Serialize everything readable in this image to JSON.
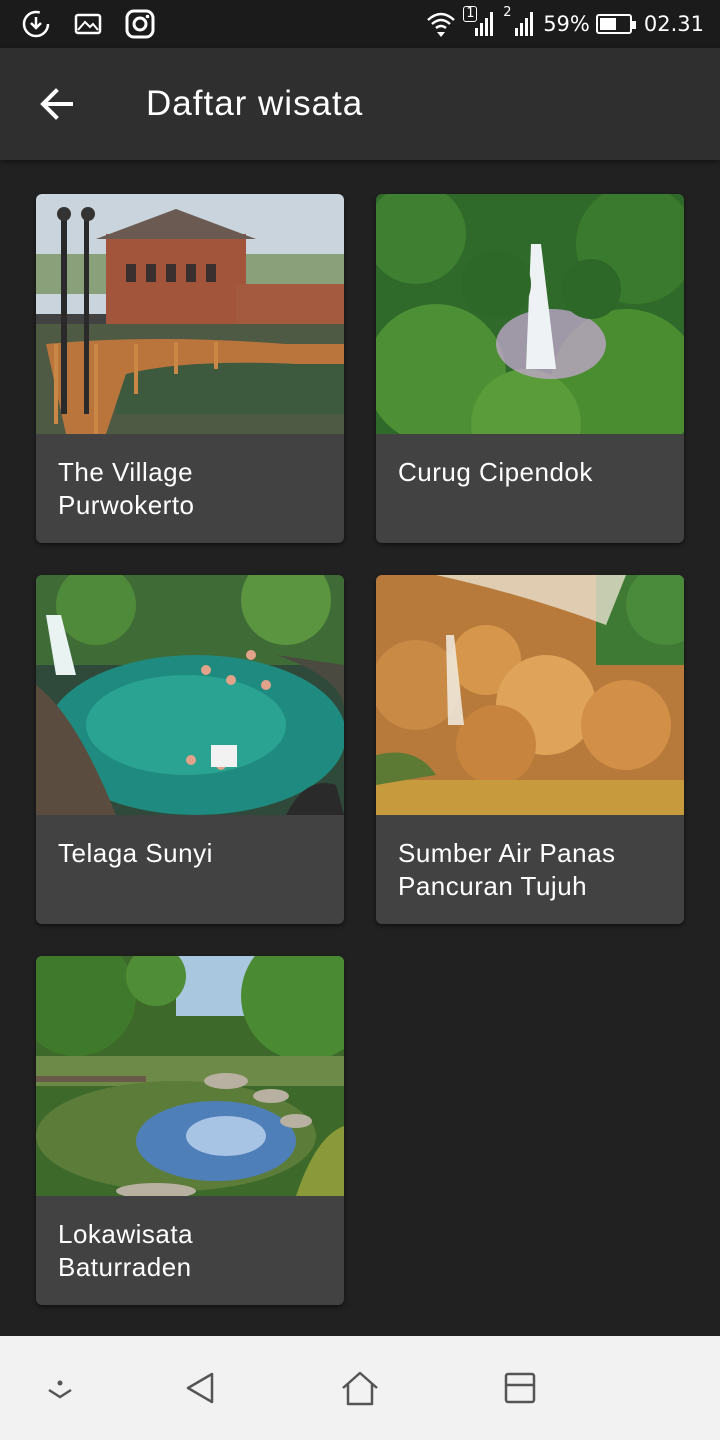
{
  "status_bar": {
    "sim1": "1",
    "sim2": "2",
    "battery_percent": "59%",
    "battery_level": 0.59,
    "time": "02.31",
    "left_icons": [
      "download-icon",
      "gallery-icon",
      "instagram-icon"
    ],
    "right_icons": [
      "wifi-icon",
      "signal-sim1-icon",
      "signal-sim2-icon",
      "battery-icon"
    ]
  },
  "app_bar": {
    "title": "Daftar wisata",
    "back_icon": "arrow-back-icon"
  },
  "places": [
    {
      "name": "The Village Purwokerto",
      "image": "village-photo"
    },
    {
      "name": "Curug Cipendok",
      "image": "waterfall-photo"
    },
    {
      "name": "Telaga Sunyi",
      "image": "lake-swimmers-photo"
    },
    {
      "name": "Sumber Air Panas Pancuran Tujuh",
      "image": "hot-spring-photo"
    },
    {
      "name": "Lokawisata Baturraden",
      "image": "river-forest-photo"
    }
  ],
  "nav_bar": {
    "icons": [
      "expand-down-icon",
      "back-triangle-icon",
      "home-icon",
      "recents-icon"
    ]
  },
  "colors": {
    "background": "#212121",
    "app_bar": "#2f2f2f",
    "card": "#424242",
    "nav_bar": "#f2f2f2"
  }
}
